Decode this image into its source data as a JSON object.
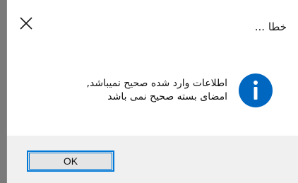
{
  "dialog": {
    "title": "خطا ...",
    "close_icon": "close-icon",
    "icon": "info-icon",
    "message_line1": "اطلاعات وارد شده صحیح نمیباشد,",
    "message_line2": "امضای بسته صحیح نمی باشد",
    "ok_label": "OK"
  },
  "colors": {
    "info_blue": "#0067c0",
    "button_border": "#0078d7",
    "footer_bg": "#f0f0f0"
  }
}
